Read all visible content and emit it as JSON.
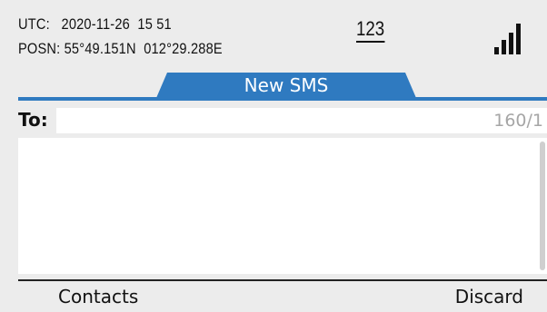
{
  "status": {
    "utc_label": "UTC:",
    "utc_date": "2020-11-26",
    "utc_time": "15 51",
    "posn_label": "POSN:",
    "latitude": "55°49.151N",
    "longitude": "012°29.288E",
    "input_mode": "123",
    "signal_icon": "signal-strength-icon",
    "signal_level": 1.0
  },
  "tab": {
    "title": "New SMS"
  },
  "compose": {
    "to_label": "To:",
    "to_value": "",
    "char_counter": "160/1",
    "message_value": ""
  },
  "softkeys": {
    "left": "Contacts",
    "right": "Discard"
  },
  "colors": {
    "accent": "#2f7ac0",
    "background": "#ececec",
    "counter_text": "#a6a6a6"
  }
}
